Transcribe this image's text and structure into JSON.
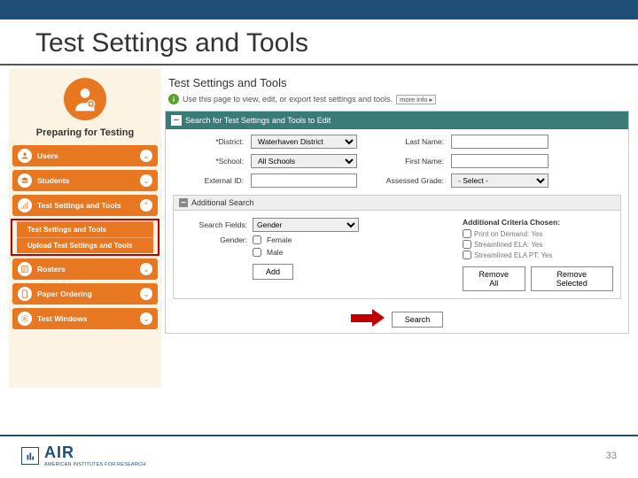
{
  "slide": {
    "title": "Test Settings and Tools",
    "page_number": "33"
  },
  "sidebar": {
    "heading": "Preparing for Testing",
    "items": [
      {
        "label": "Users"
      },
      {
        "label": "Students"
      },
      {
        "label": "Test Settings and Tools"
      },
      {
        "label": "Rosters"
      },
      {
        "label": "Paper Ordering"
      },
      {
        "label": "Test Windows"
      }
    ],
    "sub": [
      {
        "label": "Test Settings and Tools"
      },
      {
        "label": "Upload Test Settings and Tools"
      }
    ]
  },
  "main": {
    "page_title": "Test Settings and Tools",
    "info_text": "Use this page to view, edit, or export test settings and tools.",
    "more_info": "more info ▸",
    "panel_title": "Search for Test Settings and Tools to Edit",
    "fields": {
      "district_label": "*District:",
      "district_value": "Waterhaven District",
      "school_label": "*School:",
      "school_value": "All Schools",
      "external_label": "External ID:",
      "lastname_label": "Last Name:",
      "firstname_label": "First Name:",
      "grade_label": "Assessed Grade:",
      "grade_value": "- Select -"
    },
    "additional": {
      "title": "Additional Search",
      "search_fields_label": "Search Fields:",
      "search_fields_value": "Gender",
      "gender_label": "Gender:",
      "opt_female": "Female",
      "opt_male": "Male",
      "add_btn": "Add",
      "criteria_hdr": "Additional Criteria Chosen:",
      "crit1": "Print on Demand: Yes",
      "crit2": "Streamlined ELA: Yes",
      "crit3": "Streamlined ELA PT: Yes",
      "remove_all": "Remove All",
      "remove_sel": "Remove Selected"
    },
    "search_btn": "Search"
  },
  "footer": {
    "air": "AIR",
    "air_sub": "AMERICAN INSTITUTES FOR RESEARCH"
  }
}
